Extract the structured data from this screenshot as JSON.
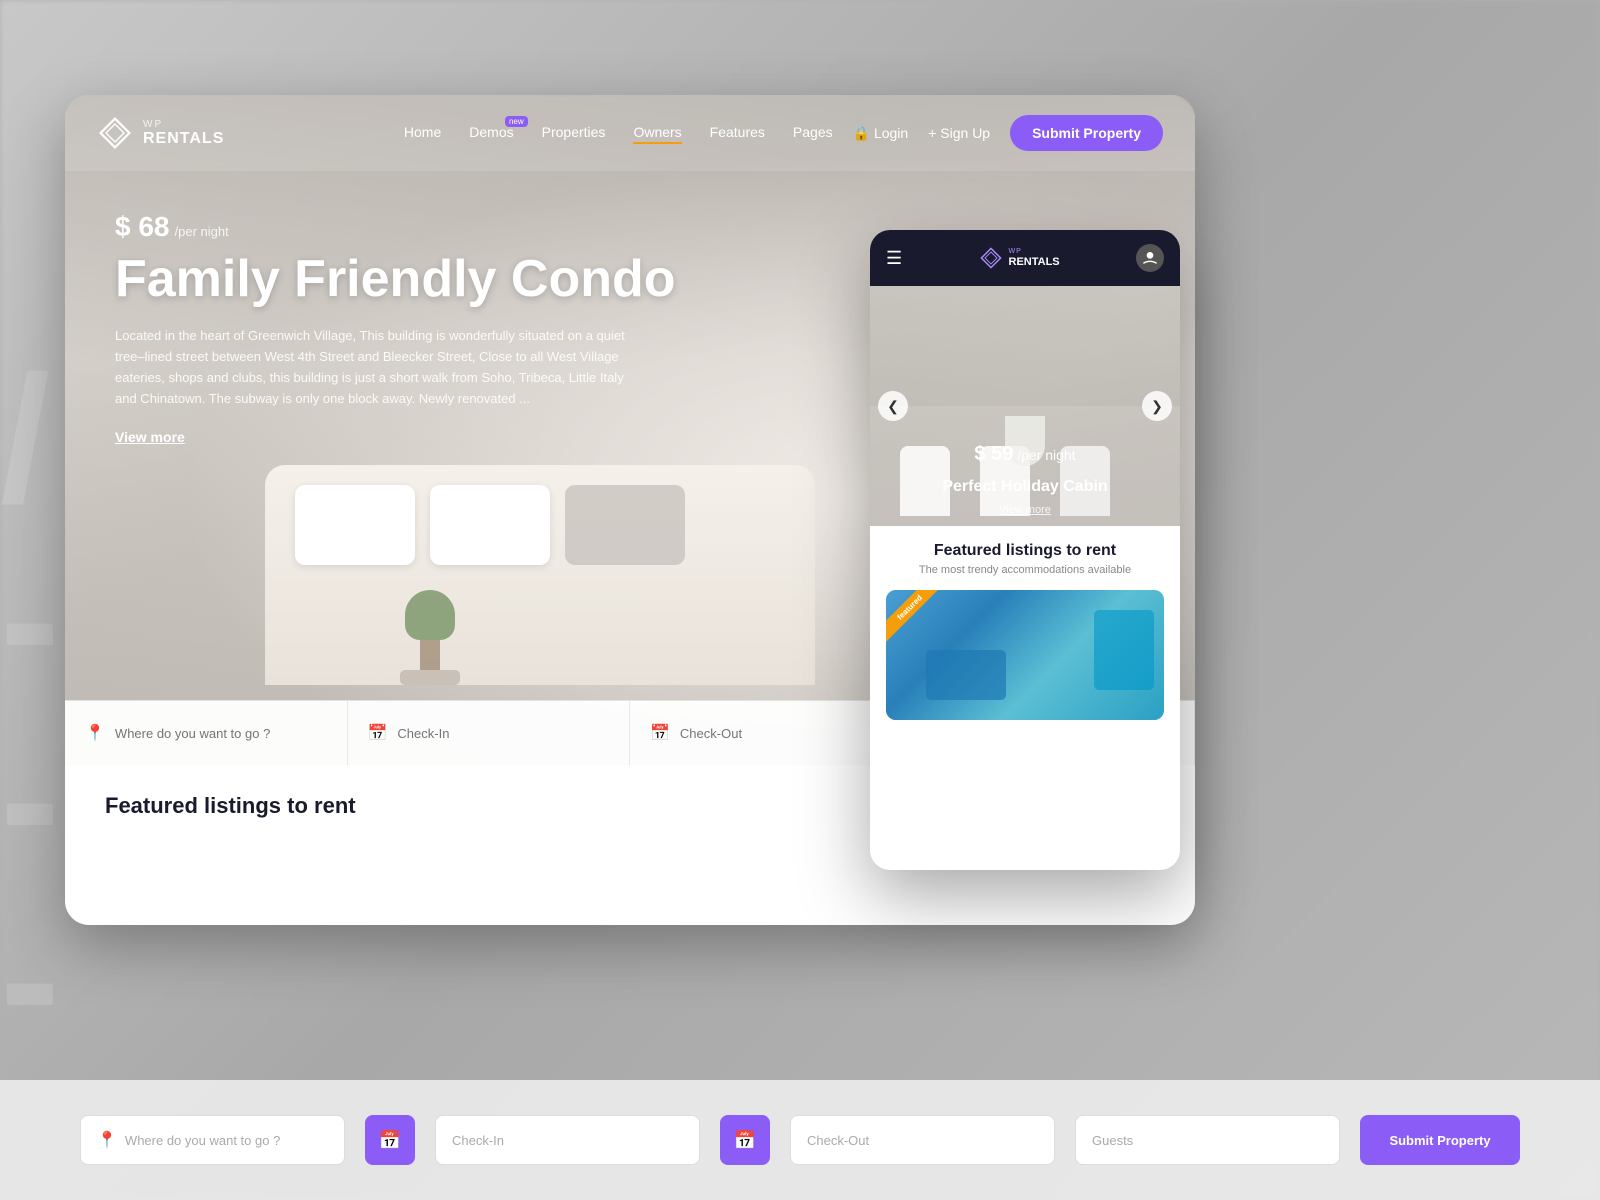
{
  "brand": {
    "wp_label": "WP",
    "rentals_label": "RENTALS"
  },
  "nav": {
    "home": "Home",
    "demos": "Demos",
    "demos_badge": "new",
    "properties": "Properties",
    "owners": "Owners",
    "features": "Features",
    "pages": "Pages",
    "login": "Login",
    "signup": "+ Sign Up",
    "submit_property": "Submit Property"
  },
  "hero": {
    "price": "$ 68",
    "price_unit": "/per night",
    "title": "Family Friendly Condo",
    "description": "Located in the heart of Greenwich Village, This building is wonderfully situated on a quiet tree–lined street between West 4th Street and Bleecker Street, Close to all West Village eateries, shops and clubs, this building is just a short walk from Soho, Tribeca, Little Italy and Chinatown. The subway is only one block away. Newly renovated ...",
    "view_more": "View more"
  },
  "search": {
    "location_placeholder": "Where do you want to go ?",
    "checkin_placeholder": "Check-In",
    "checkout_placeholder": "Check-Out",
    "guests_placeholder": "Guests"
  },
  "featured": {
    "title": "Featured listings to rent"
  },
  "mobile": {
    "property_price": "$ 59",
    "property_price_unit": "/per night",
    "property_title": "Perfect Holiday Cabin",
    "view_more": "View more",
    "featured_title": "Featured listings to rent",
    "featured_subtitle": "The most trendy accommodations available",
    "featured_badge": "featured",
    "prev_arrow": "❮",
    "next_arrow": "❯",
    "hamburger": "☰"
  },
  "colors": {
    "primary": "#8b5cf6",
    "accent": "#f59e0b",
    "dark": "#1a1a2e",
    "nav_underline": "#f59e0b"
  }
}
